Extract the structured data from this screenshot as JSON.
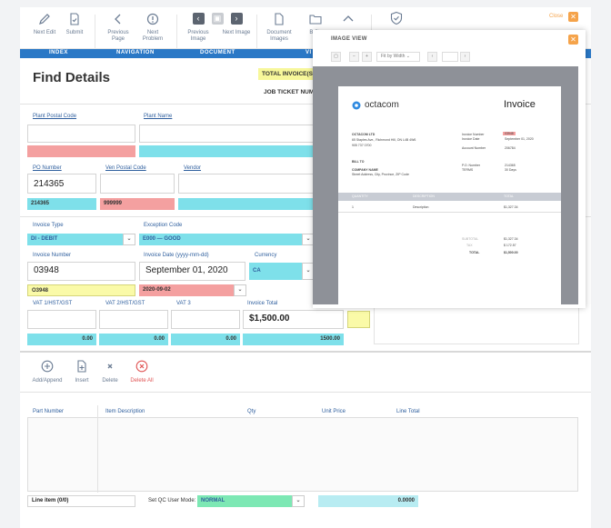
{
  "toolbar": {
    "next_edit": "Next Edit",
    "submit": "Submit",
    "previous_page": "Previous Page",
    "next_problem": "Next Problem",
    "previous_image": "Previous Image",
    "next_image": "Next Image",
    "document_images": "Document Images",
    "b_str": "B Str",
    "close": "Close"
  },
  "nav_sections": [
    "INDEX",
    "NAVIGATION",
    "DOCUMENT",
    "VI"
  ],
  "page_title": "Find Details",
  "invoice_label": "TOTAL INVOICE(S)",
  "job_ticket": "JOB TICKET NUM",
  "fields": {
    "plant_postal_code": "Plant Postal Code",
    "plant_name": "Plant Name",
    "po_number": "PO Number",
    "po_number_value": "214365",
    "po_number_check": "214365",
    "ven_postal_code": "Ven Postal Code",
    "ven_postal_check": "999999",
    "vendor": "Vendor",
    "invoice_type": "Invoice Type",
    "invoice_type_value": "DI - DEBIT",
    "exception_code": "Exception Code",
    "exception_value": "E000 — GOOD",
    "invoice_number": "Invoice Number",
    "invoice_number_value": "03948",
    "invoice_number_check": "O3948",
    "invoice_date": "Invoice Date (yyyy-mm-dd)",
    "invoice_date_value": "September 01, 2020",
    "invoice_date_check": "2020-09-02",
    "currency": "Currency",
    "currency_value": "CA",
    "vat1": "VAT 1/HST/GST",
    "vat2": "VAT 2/HST/GST",
    "vat3": "VAT 3",
    "invoice_total": "Invoice Total",
    "invoice_total_value": "$1,500.00",
    "vat1_check": "0.00",
    "vat2_check": "0.00",
    "vat3_check": "0.00",
    "total_check": "1500.00"
  },
  "actions": {
    "add_append": "Add/Append",
    "insert": "Insert",
    "delete": "Delete",
    "delete_all": "Delete All"
  },
  "line_headers": [
    "Part Number",
    "Item Description",
    "Qty",
    "Unit Price",
    "Line Total"
  ],
  "footer": {
    "line_item": "Line item (0/0)",
    "qc_label": "Set QC User Mode:",
    "qc_value": "NORMAL",
    "amount": "0.0000"
  },
  "image_view": {
    "title": "IMAGE VIEW",
    "zoom_mode": "Fit by Width",
    "doc": {
      "brand": "octacom",
      "heading": "Invoice",
      "company": "OCTACOM LTD",
      "address": "65 Staples Ave., Richmond Hill, ON L4B 4W6",
      "phone": "905 737 0700",
      "invoice_number_lbl": "Invoice Number",
      "invoice_number": "03948",
      "invoice_date_lbl": "Invoice Date",
      "invoice_date": "September 01, 2020",
      "account_number_lbl": "Account Number",
      "account_number": "206784",
      "bill_to": "BILL TO",
      "company_name": "COMPANY NAME",
      "street": "Street Address, City, Province, ZIP Code",
      "po_lbl": "P.O. Number",
      "po": "214365",
      "terms_lbl": "TERMS",
      "terms": "30 Days",
      "col_qty": "QUANTITY",
      "col_desc": "DESCRIPTION",
      "col_total": "TOTAL",
      "row_qty": "1",
      "row_desc": "Description",
      "row_total": "$1,327.34",
      "subtotal_lbl": "SUBTOTAL",
      "subtotal": "$1,327.34",
      "tax_lbl": "TAX",
      "tax": "$   172.57",
      "total_lbl": "TOTAL",
      "total": "$1,500.00"
    }
  },
  "colors": {
    "accent": "#2a78c6",
    "close": "#f5a34a",
    "pink": "#f4a0a0",
    "cyan": "#7ee0ea",
    "yellow": "#fafaa8"
  }
}
